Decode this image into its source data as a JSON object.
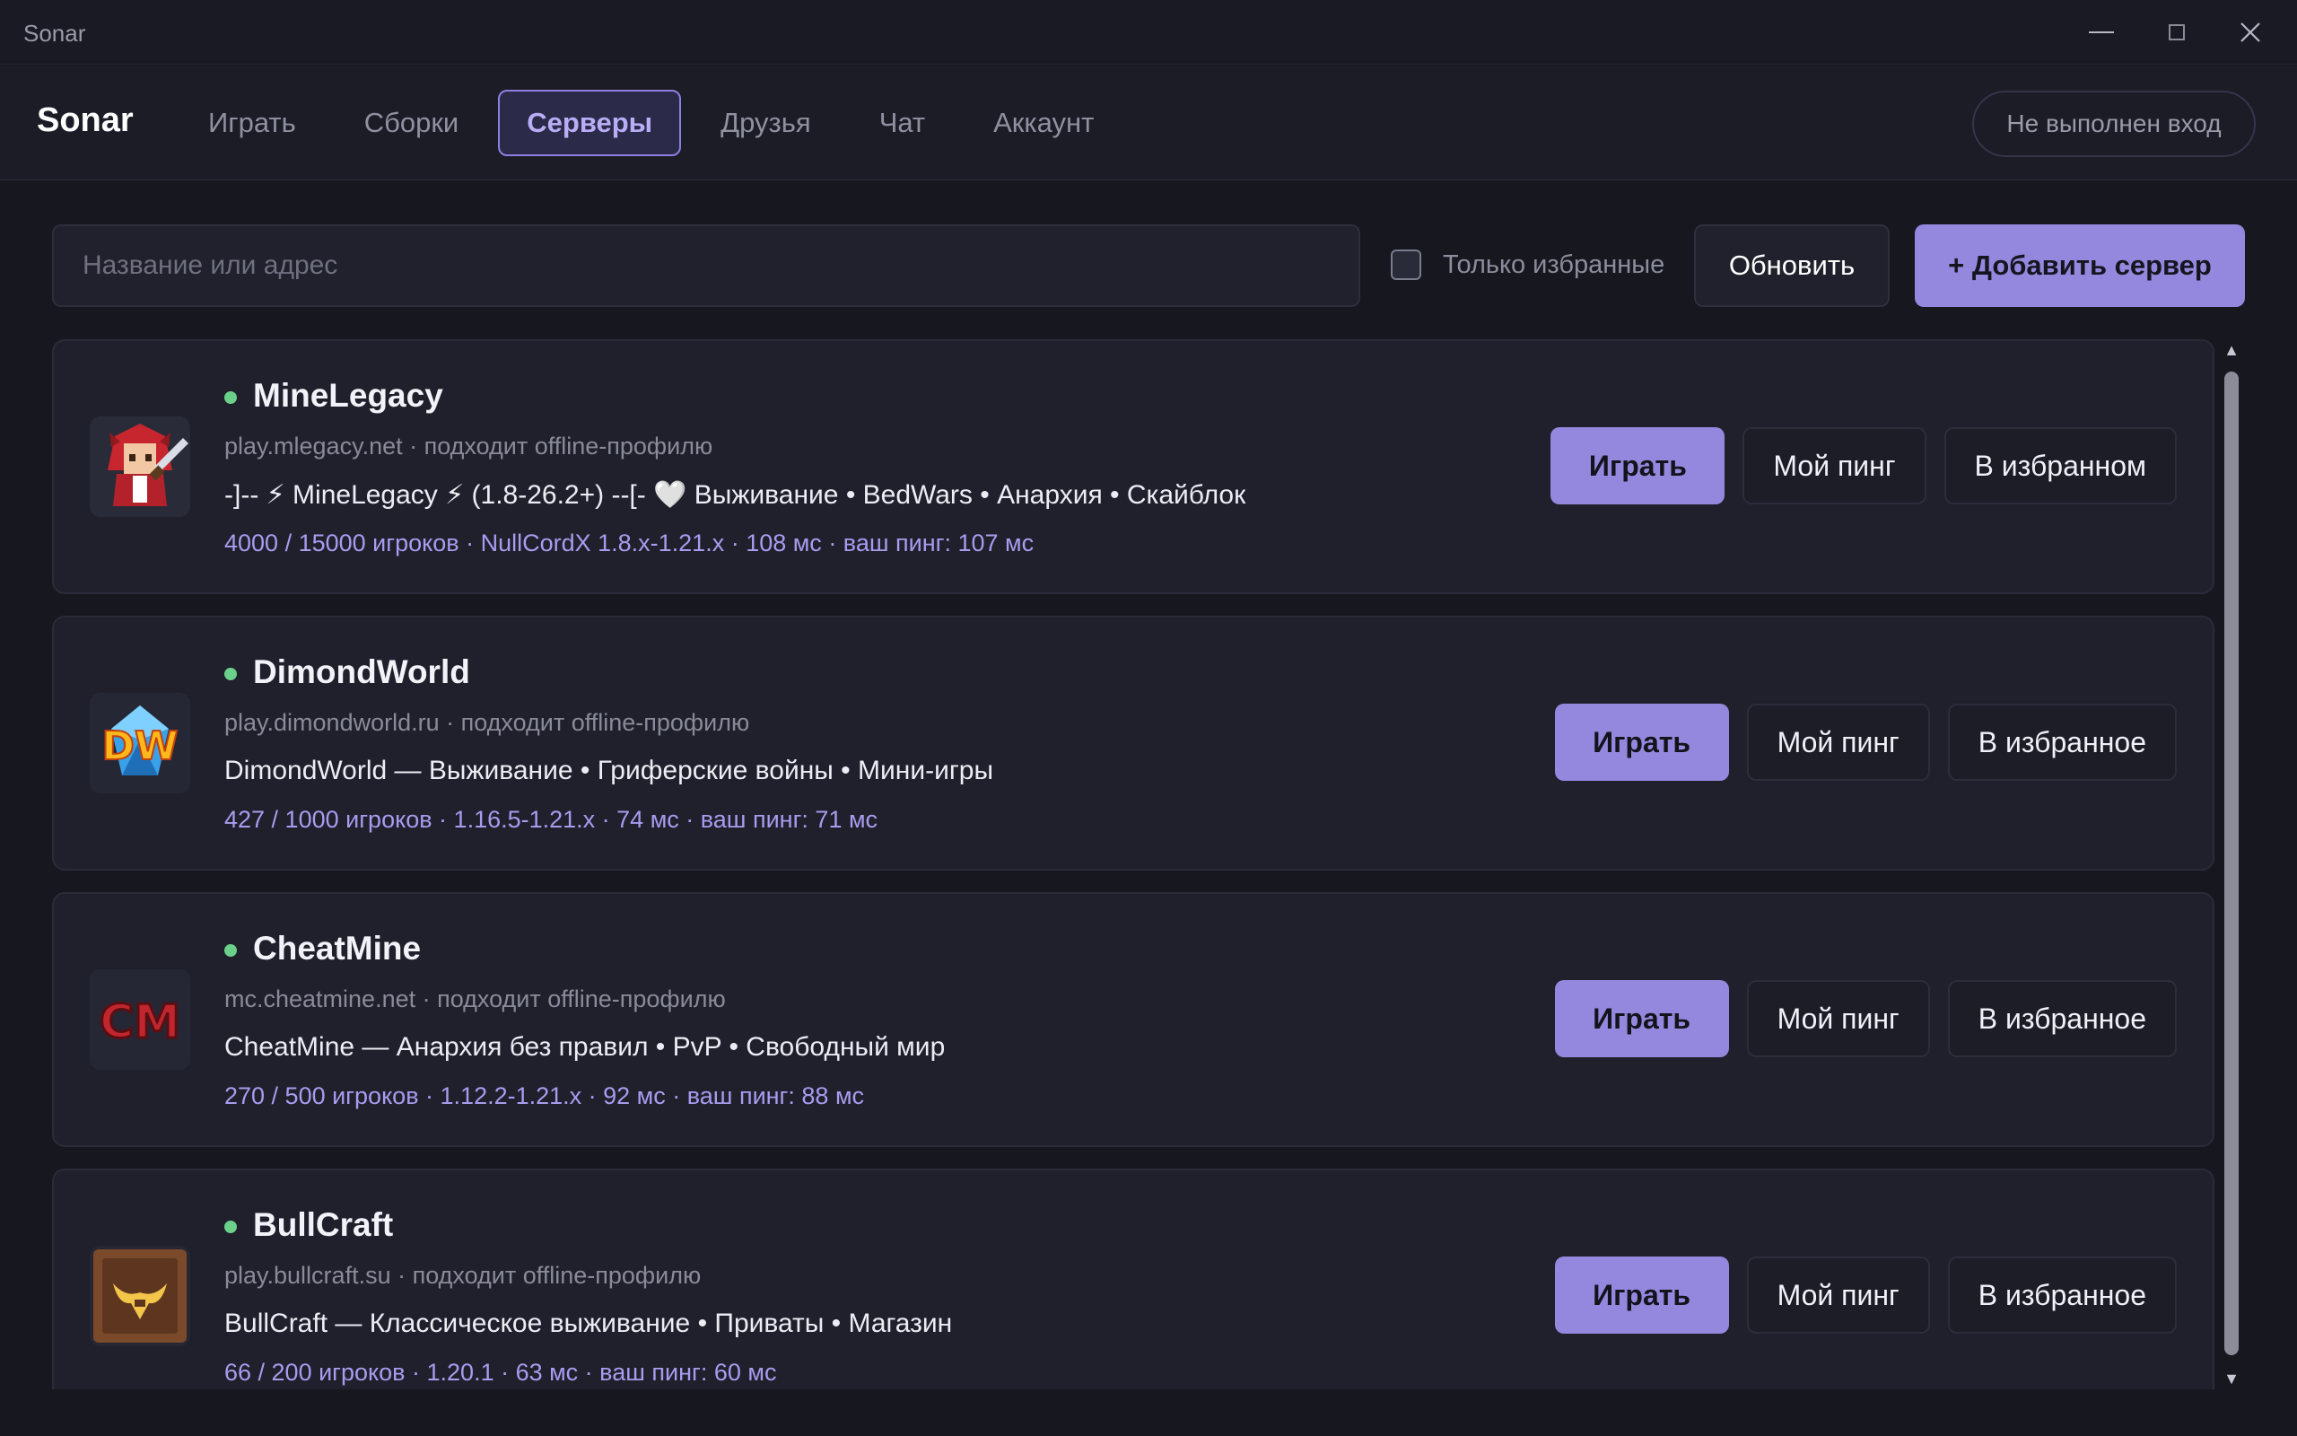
{
  "window": {
    "title": "Sonar",
    "minimize_icon": "minimize-icon",
    "maximize_icon": "maximize-icon",
    "close_icon": "close-icon"
  },
  "header": {
    "brand": "Sonar",
    "tabs": [
      {
        "label": "Играть",
        "active": false
      },
      {
        "label": "Сборки",
        "active": false
      },
      {
        "label": "Серверы",
        "active": true
      },
      {
        "label": "Друзья",
        "active": false
      },
      {
        "label": "Чат",
        "active": false
      },
      {
        "label": "Аккаунт",
        "active": false
      }
    ],
    "login_status": "Не выполнен вход"
  },
  "toolbar": {
    "search_placeholder": "Название или адрес",
    "search_value": "",
    "favorites_only_label": "Только избранные",
    "favorites_only_checked": false,
    "refresh_label": "Обновить",
    "add_server_label": "+ Добавить сервер"
  },
  "servers": [
    {
      "name": "MineLegacy",
      "online": true,
      "address": "play.mlegacy.net · подходит offline-профилю",
      "motd": "-]-- ⚡ MineLegacy ⚡ (1.8-26.2+) --[- 🤍 Выживание • BedWars • Анархия • Скайблок",
      "stats": "4000 / 15000 игроков · NullCordX 1.8.x-1.21.x · 108 мс · ваш пинг: 107 мс",
      "icon": "minelegacy-logo",
      "play_label": "Играть",
      "ping_label": "Мой пинг",
      "favorite_label": "В избранном"
    },
    {
      "name": "DimondWorld",
      "online": true,
      "address": "play.dimondworld.ru · подходит offline-профилю",
      "motd": "DimondWorld — Выживание • Гриферские войны • Мини-игры",
      "stats": "427 / 1000 игроков · 1.16.5-1.21.x · 74 мс · ваш пинг: 71 мс",
      "icon": "dimondworld-logo",
      "logo_text": "DW",
      "play_label": "Играть",
      "ping_label": "Мой пинг",
      "favorite_label": "В избранное"
    },
    {
      "name": "CheatMine",
      "online": true,
      "address": "mc.cheatmine.net · подходит offline-профилю",
      "motd": "CheatMine — Анархия без правил • PvP • Свободный мир",
      "stats": "270 / 500 игроков · 1.12.2-1.21.x · 92 мс · ваш пинг: 88 мс",
      "icon": "cheatmine-logo",
      "logo_text": "CM",
      "play_label": "Играть",
      "ping_label": "Мой пинг",
      "favorite_label": "В избранное"
    },
    {
      "name": "BullCraft",
      "online": true,
      "address": "play.bullcraft.su · подходит offline-профилю",
      "motd": "BullCraft — Классическое выживание • Приваты • Магазин",
      "stats": "66 / 200 игроков · 1.20.1 · 63 мс · ваш пинг: 60 мс",
      "icon": "bullcraft-logo",
      "play_label": "Играть",
      "ping_label": "Мой пинг",
      "favorite_label": "В избранное"
    }
  ],
  "colors": {
    "accent": "#9488de",
    "online": "#6bd08a",
    "background": "#16171f",
    "card": "#1f202b",
    "stats_text": "#a79cf0"
  }
}
